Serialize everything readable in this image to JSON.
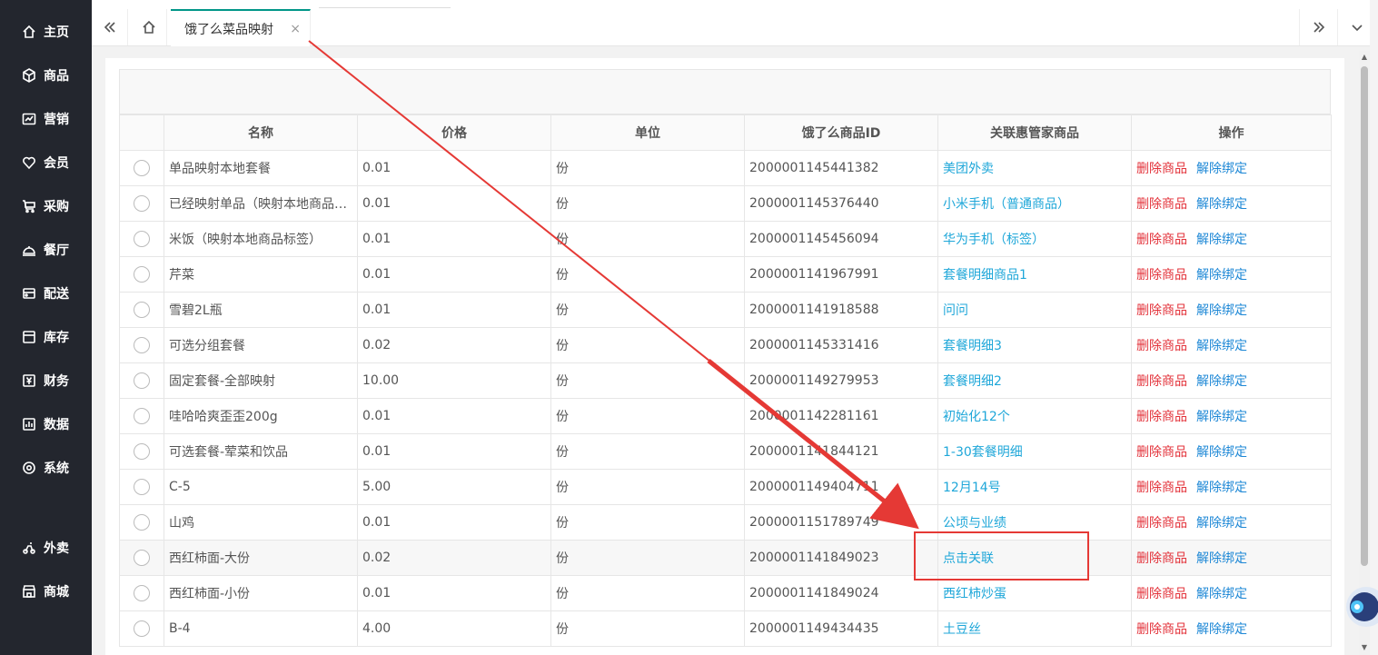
{
  "sidebar": {
    "items": [
      {
        "label": "主页",
        "icon": "home-icon"
      },
      {
        "label": "商品",
        "icon": "cube-icon"
      },
      {
        "label": "营销",
        "icon": "chart-icon"
      },
      {
        "label": "会员",
        "icon": "heart-icon"
      },
      {
        "label": "采购",
        "icon": "cart-icon"
      },
      {
        "label": "餐厅",
        "icon": "cloche-icon"
      },
      {
        "label": "配送",
        "icon": "delivery-icon"
      },
      {
        "label": "库存",
        "icon": "box-icon"
      },
      {
        "label": "财务",
        "icon": "yen-icon"
      },
      {
        "label": "数据",
        "icon": "data-icon"
      },
      {
        "label": "系统",
        "icon": "settings-icon"
      },
      {
        "label": "外卖",
        "icon": "scooter-icon"
      },
      {
        "label": "商城",
        "icon": "store-icon"
      }
    ]
  },
  "tabs": {
    "active_label": "饿了么菜品映射",
    "close_glyph": "×"
  },
  "table": {
    "columns": [
      "名称",
      "价格",
      "单位",
      "饿了么商品ID",
      "关联惠管家商品",
      "操作"
    ],
    "action_delete": "删除商品",
    "action_unbind": "解除绑定",
    "rows": [
      {
        "name": "单品映射本地套餐",
        "price": "0.01",
        "unit": "份",
        "eleme_id": "2000001145441382",
        "linked": "美团外卖"
      },
      {
        "name": "已经映射单品（映射本地商品…",
        "price": "0.01",
        "unit": "份",
        "eleme_id": "2000001145376440",
        "linked": "小米手机（普通商品）"
      },
      {
        "name": "米饭（映射本地商品标签）",
        "price": "0.01",
        "unit": "份",
        "eleme_id": "2000001145456094",
        "linked": "华为手机（标签）"
      },
      {
        "name": "芹菜",
        "price": "0.01",
        "unit": "份",
        "eleme_id": "2000001141967991",
        "linked": "套餐明细商品1"
      },
      {
        "name": "雪碧2L瓶",
        "price": "0.01",
        "unit": "份",
        "eleme_id": "2000001141918588",
        "linked": "问问"
      },
      {
        "name": "可选分组套餐",
        "price": "0.02",
        "unit": "份",
        "eleme_id": "2000001145331416",
        "linked": "套餐明细3"
      },
      {
        "name": "固定套餐-全部映射",
        "price": "10.00",
        "unit": "份",
        "eleme_id": "2000001149279953",
        "linked": "套餐明细2"
      },
      {
        "name": "哇哈哈爽歪歪200g",
        "price": "0.01",
        "unit": "份",
        "eleme_id": "2000001142281161",
        "linked": "初始化12个"
      },
      {
        "name": "可选套餐-荤菜和饮品",
        "price": "0.01",
        "unit": "份",
        "eleme_id": "2000001141844121",
        "linked": "1-30套餐明细"
      },
      {
        "name": "C-5",
        "price": "5.00",
        "unit": "份",
        "eleme_id": "2000001149404711",
        "linked": "12月14号"
      },
      {
        "name": "山鸡",
        "price": "0.01",
        "unit": "份",
        "eleme_id": "2000001151789749",
        "linked": "公顷与业绩"
      },
      {
        "name": "西红柿面-大份",
        "price": "0.02",
        "unit": "份",
        "eleme_id": "2000001141849023",
        "linked": "点击关联"
      },
      {
        "name": "西红柿面-小份",
        "price": "0.01",
        "unit": "份",
        "eleme_id": "2000001141849024",
        "linked": "西红柿炒蛋"
      },
      {
        "name": "B-4",
        "price": "4.00",
        "unit": "份",
        "eleme_id": "2000001149434435",
        "linked": "土豆丝"
      }
    ]
  },
  "colors": {
    "sidebar_bg": "#23262e",
    "tab_accent": "#009688",
    "link_blue": "#1fa7d9",
    "link_red": "#e3323a",
    "annotation_red": "#e53935"
  }
}
